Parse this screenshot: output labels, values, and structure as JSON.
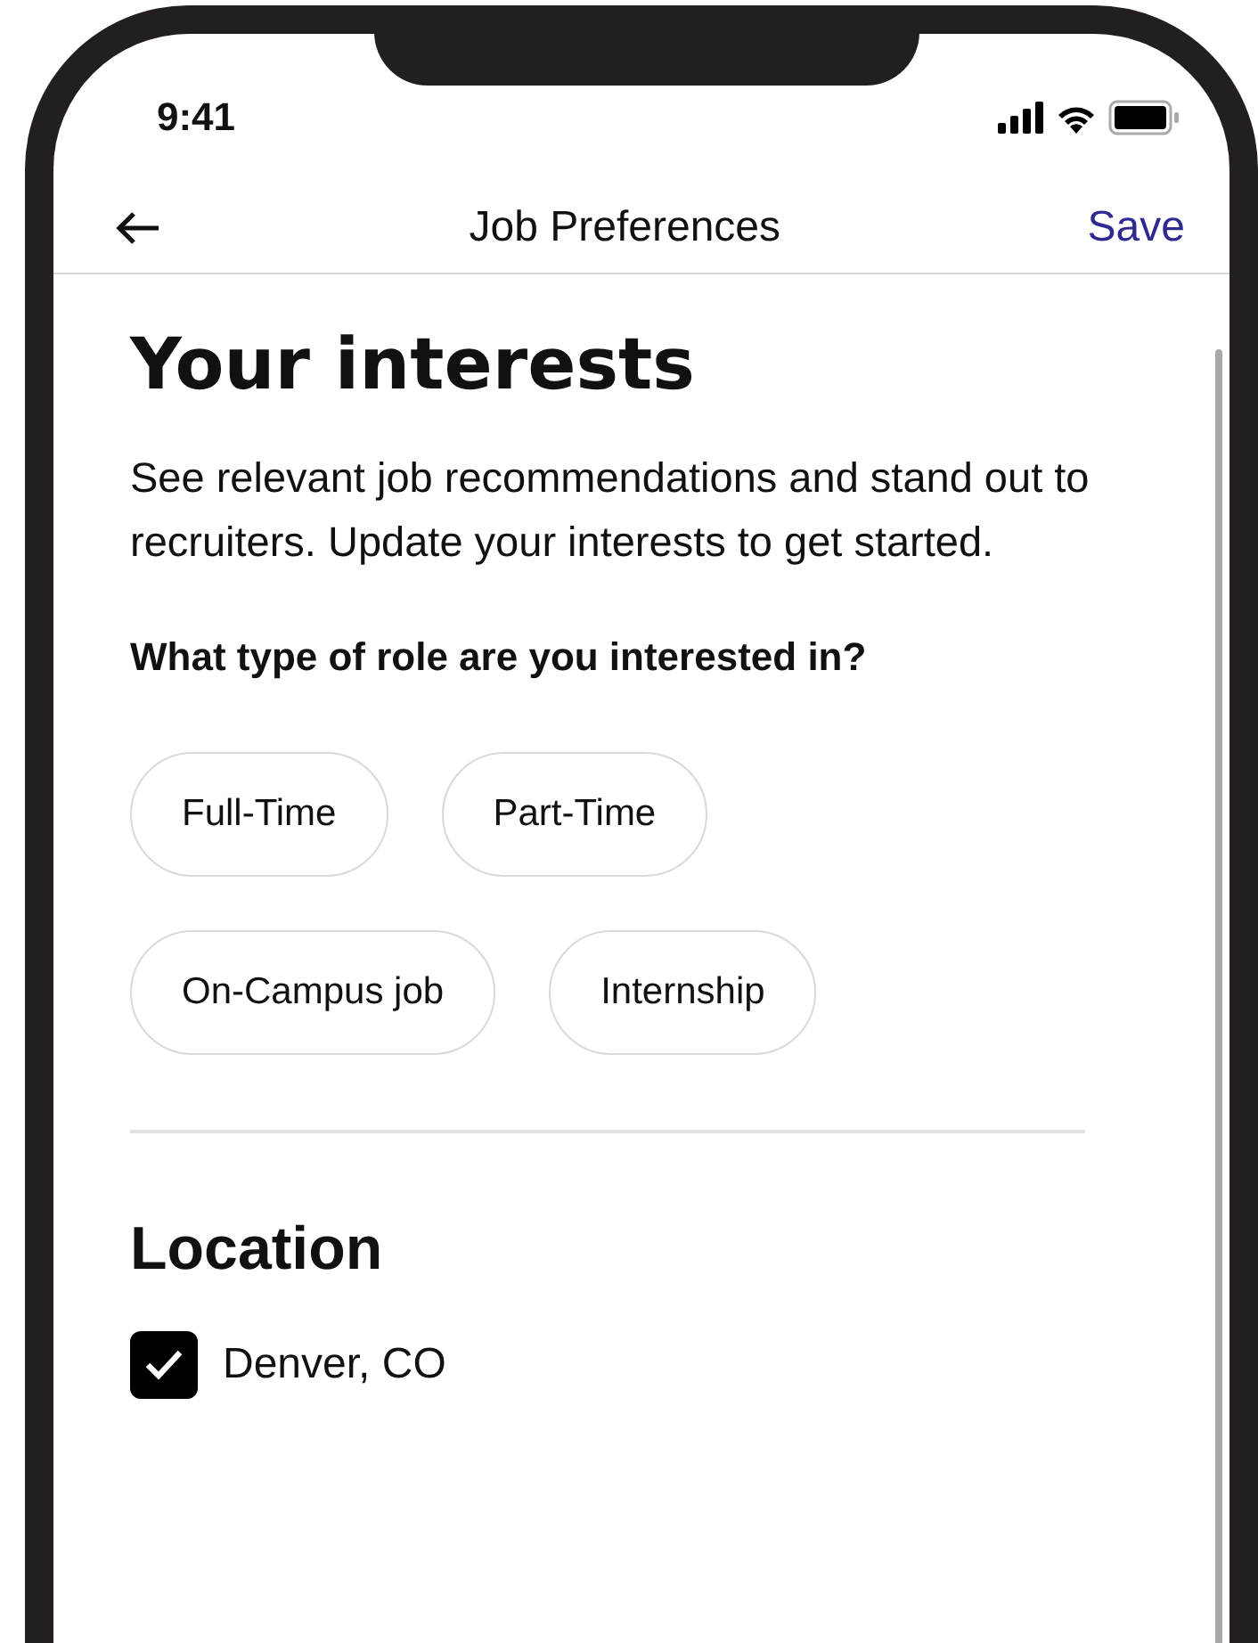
{
  "status_bar": {
    "time": "9:41"
  },
  "header": {
    "title": "Job Preferences",
    "action": "Save"
  },
  "heading": "Your interests",
  "description": "See relevant job recommendations and stand out to recruiters. Update your interests to get started.",
  "question": "What type of role are you interested in?",
  "role_options": [
    [
      {
        "label": "Full-Time",
        "selected": false
      },
      {
        "label": "Part-Time",
        "selected": false
      }
    ],
    [
      {
        "label": "On-Campus job",
        "selected": false
      },
      {
        "label": "Internship",
        "selected": false
      }
    ]
  ],
  "location": {
    "title": "Location",
    "options": [
      {
        "label": "Denver, CO",
        "checked": true
      }
    ]
  }
}
